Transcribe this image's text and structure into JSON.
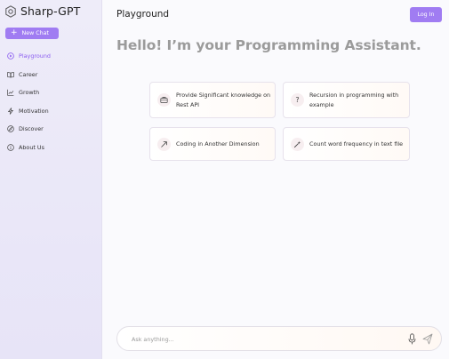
{
  "brand": {
    "name": "Sharp-GPT",
    "icon": "hexagon-logo-icon"
  },
  "sidebar": {
    "new_chat_label": "New Chat",
    "items": [
      {
        "label": "Playground",
        "icon": "play-circle-icon",
        "active": true
      },
      {
        "label": "Career",
        "icon": "book-icon",
        "active": false
      },
      {
        "label": "Growth",
        "icon": "chart-line-icon",
        "active": false
      },
      {
        "label": "Motivation",
        "icon": "bolt-icon",
        "active": false
      },
      {
        "label": "Discover",
        "icon": "compass-icon",
        "active": false
      },
      {
        "label": "About Us",
        "icon": "info-icon",
        "active": false
      }
    ]
  },
  "header": {
    "title": "Playground",
    "login_label": "Log In"
  },
  "main": {
    "greeting": "Hello! I’m your Programming Assistant.",
    "suggestions": [
      {
        "text": "Provide Significant knowledge on Rest API",
        "icon": "briefcase-icon"
      },
      {
        "text": "Recursion in programming with example",
        "icon": "question-icon"
      },
      {
        "text": "Coding in Another Dimension",
        "icon": "arrow-up-right-icon"
      },
      {
        "text": "Count word frequency in text file",
        "icon": "magic-wand-icon"
      }
    ]
  },
  "composer": {
    "placeholder": "Ask anything...",
    "value": ""
  },
  "colors": {
    "accent": "#a07cf2",
    "active_text": "#8a5cf0",
    "sidebar_bg": "#eeecf9"
  }
}
